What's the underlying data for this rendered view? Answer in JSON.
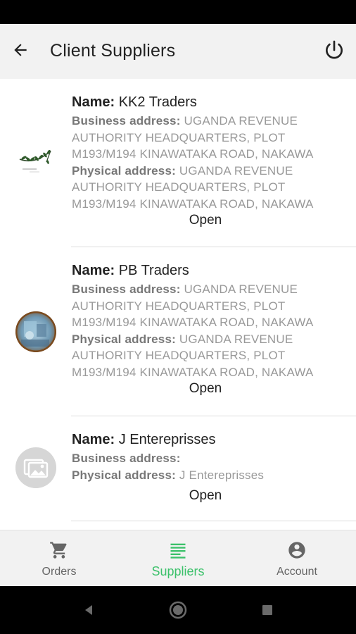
{
  "app_bar": {
    "title": "Client Suppliers",
    "back_icon": "arrow-left-icon",
    "power_icon": "power-icon"
  },
  "suppliers": [
    {
      "name_label": "Name:",
      "name": "KK2 Traders",
      "business_label": "Business address:",
      "business_address": "UGANDA REVENUE AUTHORITY HEADQUARTERS, PLOT M193/M194 KINAWATAKA ROAD, NAKAWA",
      "physical_label": "Physical address:",
      "physical_address": "UGANDA REVENUE AUTHORITY HEADQUARTERS, PLOT M193/M194 KINAWATAKA ROAD, NAKAWA",
      "action": "Open",
      "avatar": "leaf-logo"
    },
    {
      "name_label": "Name:",
      "name": "PB Traders",
      "business_label": "Business address:",
      "business_address": "UGANDA REVENUE AUTHORITY HEADQUARTERS, PLOT M193/M194 KINAWATAKA ROAD, NAKAWA",
      "physical_label": "Physical address:",
      "physical_address": "UGANDA REVENUE AUTHORITY HEADQUARTERS, PLOT M193/M194 KINAWATAKA ROAD, NAKAWA",
      "action": "Open",
      "avatar": "photo"
    },
    {
      "name_label": "Name:",
      "name": "J Entereprisses",
      "business_label": "Business address:",
      "business_address": "",
      "physical_label": "Physical address:",
      "physical_address": "J Entereprisses",
      "action": "Open",
      "avatar": "image-placeholder-icon"
    }
  ],
  "bottom_nav": {
    "items": [
      {
        "label": "Orders",
        "icon": "cart-icon",
        "active": false
      },
      {
        "label": "Suppliers",
        "icon": "list-icon",
        "active": true
      },
      {
        "label": "Account",
        "icon": "account-icon",
        "active": false
      }
    ],
    "active_color": "#3bc16a",
    "inactive_color": "#666666"
  },
  "system_nav": {
    "back_icon": "triangle-back-icon",
    "home_icon": "circle-home-icon",
    "recents_icon": "square-recents-icon"
  }
}
